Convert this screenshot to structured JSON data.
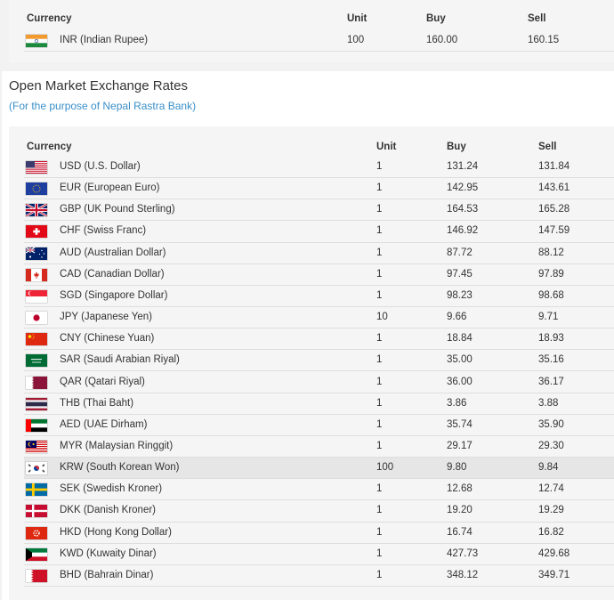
{
  "top_table": {
    "headers": {
      "currency": "Currency",
      "unit": "Unit",
      "buy": "Buy",
      "sell": "Sell"
    },
    "rows": [
      {
        "flag": "india-flag-icon",
        "currency": "INR (Indian Rupee)",
        "unit": "100",
        "buy": "160.00",
        "sell": "160.15"
      }
    ]
  },
  "section": {
    "title": "Open Market Exchange Rates",
    "subtitle": "(For the purpose of Nepal Rastra Bank)"
  },
  "main_table": {
    "headers": {
      "currency": "Currency",
      "unit": "Unit",
      "buy": "Buy",
      "sell": "Sell"
    },
    "rows": [
      {
        "flag": "usa-flag-icon",
        "currency": "USD (U.S. Dollar)",
        "unit": "1",
        "buy": "131.24",
        "sell": "131.84"
      },
      {
        "flag": "eu-flag-icon",
        "currency": "EUR (European Euro)",
        "unit": "1",
        "buy": "142.95",
        "sell": "143.61"
      },
      {
        "flag": "uk-flag-icon",
        "currency": "GBP (UK Pound Sterling)",
        "unit": "1",
        "buy": "164.53",
        "sell": "165.28"
      },
      {
        "flag": "swiss-flag-icon",
        "currency": "CHF (Swiss Franc)",
        "unit": "1",
        "buy": "146.92",
        "sell": "147.59"
      },
      {
        "flag": "australia-flag-icon",
        "currency": "AUD (Australian Dollar)",
        "unit": "1",
        "buy": "87.72",
        "sell": "88.12"
      },
      {
        "flag": "canada-flag-icon",
        "currency": "CAD (Canadian Dollar)",
        "unit": "1",
        "buy": "97.45",
        "sell": "97.89"
      },
      {
        "flag": "singapore-flag-icon",
        "currency": "SGD (Singapore Dollar)",
        "unit": "1",
        "buy": "98.23",
        "sell": "98.68"
      },
      {
        "flag": "japan-flag-icon",
        "currency": "JPY (Japanese Yen)",
        "unit": "10",
        "buy": "9.66",
        "sell": "9.71"
      },
      {
        "flag": "china-flag-icon",
        "currency": "CNY (Chinese Yuan)",
        "unit": "1",
        "buy": "18.84",
        "sell": "18.93"
      },
      {
        "flag": "saudi-flag-icon",
        "currency": "SAR (Saudi Arabian Riyal)",
        "unit": "1",
        "buy": "35.00",
        "sell": "35.16"
      },
      {
        "flag": "qatar-flag-icon",
        "currency": "QAR (Qatari Riyal)",
        "unit": "1",
        "buy": "36.00",
        "sell": "36.17"
      },
      {
        "flag": "thailand-flag-icon",
        "currency": "THB (Thai Baht)",
        "unit": "1",
        "buy": "3.86",
        "sell": "3.88"
      },
      {
        "flag": "uae-flag-icon",
        "currency": "AED (UAE Dirham)",
        "unit": "1",
        "buy": "35.74",
        "sell": "35.90"
      },
      {
        "flag": "malaysia-flag-icon",
        "currency": "MYR (Malaysian Ringgit)",
        "unit": "1",
        "buy": "29.17",
        "sell": "29.30"
      },
      {
        "flag": "korea-flag-icon",
        "currency": "KRW (South Korean Won)",
        "unit": "100",
        "buy": "9.80",
        "sell": "9.84"
      },
      {
        "flag": "sweden-flag-icon",
        "currency": "SEK (Swedish Kroner)",
        "unit": "1",
        "buy": "12.68",
        "sell": "12.74"
      },
      {
        "flag": "denmark-flag-icon",
        "currency": "DKK (Danish Kroner)",
        "unit": "1",
        "buy": "19.20",
        "sell": "19.29"
      },
      {
        "flag": "hongkong-flag-icon",
        "currency": "HKD (Hong Kong Dollar)",
        "unit": "1",
        "buy": "16.74",
        "sell": "16.82"
      },
      {
        "flag": "kuwait-flag-icon",
        "currency": "KWD (Kuwaity Dinar)",
        "unit": "1",
        "buy": "427.73",
        "sell": "429.68"
      },
      {
        "flag": "bahrain-flag-icon",
        "currency": "BHD (Bahrain Dinar)",
        "unit": "1",
        "buy": "348.12",
        "sell": "349.71"
      }
    ]
  },
  "colors": {
    "subtitle": "#3a8fc8",
    "highlight_row": "#e6e6e6",
    "panel": "#f5f5f5"
  }
}
